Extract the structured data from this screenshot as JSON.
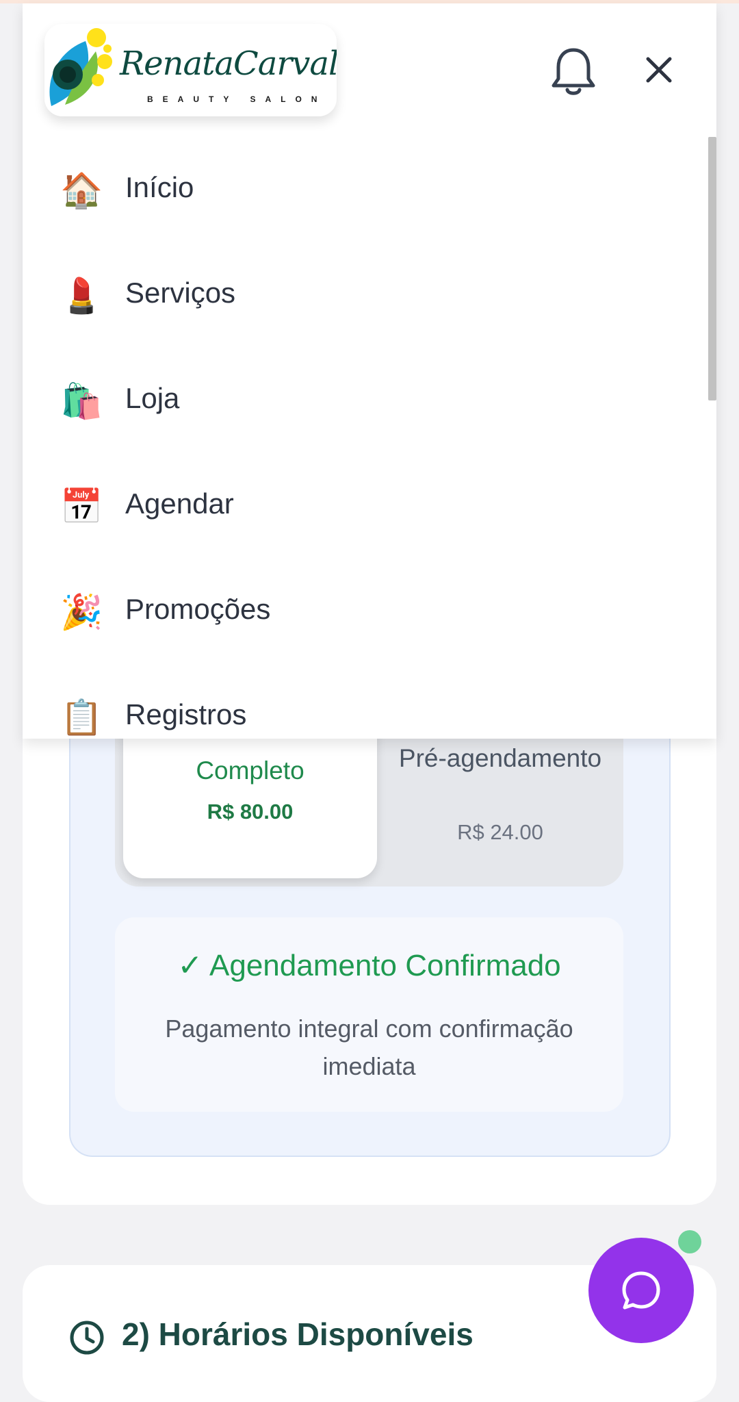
{
  "header": {
    "logo_name": "RenataCarvalhaes",
    "logo_tagline": "BEAUTY SALON",
    "bell_icon": "bell-icon",
    "close_icon": "close-icon"
  },
  "menu": {
    "items": [
      {
        "label": "Início",
        "icon": "🏠",
        "icon_name": "house-icon"
      },
      {
        "label": "Serviços",
        "icon": "💄",
        "icon_name": "lipstick-icon"
      },
      {
        "label": "Loja",
        "icon": "🛍️",
        "icon_name": "shopping-bags-icon"
      },
      {
        "label": "Agendar",
        "icon": "📅",
        "icon_name": "calendar-icon"
      },
      {
        "label": "Promoções",
        "icon": "🎉",
        "icon_name": "party-popper-icon"
      },
      {
        "label": "Registros",
        "icon": "📋",
        "icon_name": "clipboard-icon"
      }
    ]
  },
  "payment": {
    "full_label": "Completo",
    "full_price": "R$ 80.00",
    "pre_label": "Pré-agendamento",
    "pre_price": "R$ 24.00"
  },
  "confirmation": {
    "title": "✓ Agendamento Confirmado",
    "description": "Pagamento integral com confirmação imediata"
  },
  "section2": {
    "title": "2) Horários Disponíveis",
    "icon": "clock-icon"
  },
  "chat": {
    "icon": "chat-bubble-icon"
  },
  "colors": {
    "accent_purple": "#9333ea",
    "success_green": "#1f9a51",
    "online_green": "#6fd39a",
    "heading_teal": "#1d4a44"
  }
}
